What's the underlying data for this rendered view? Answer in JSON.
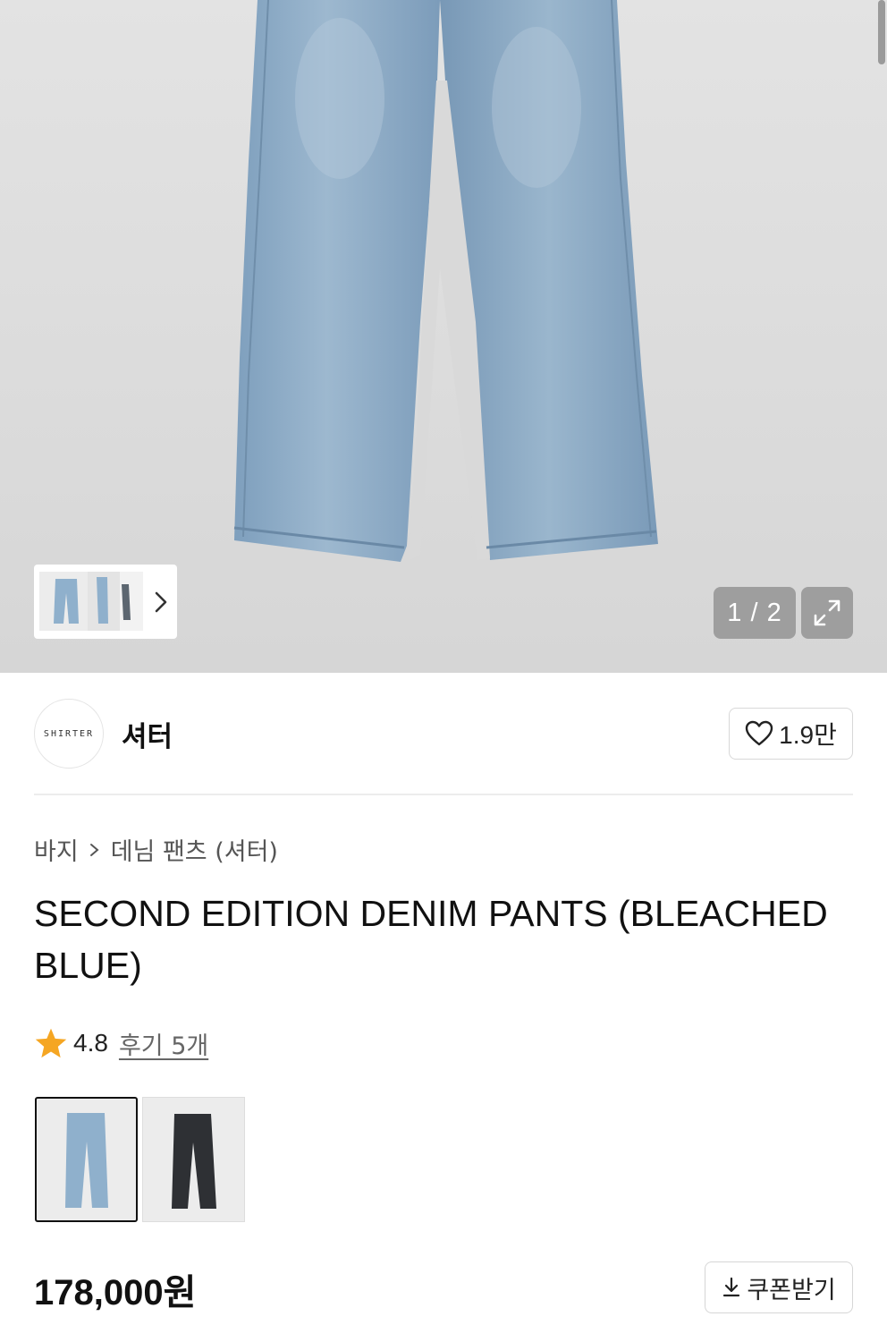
{
  "gallery": {
    "counter": "1 / 2",
    "icons": {
      "next": "chevron-right-icon",
      "expand": "expand-icon"
    }
  },
  "brand": {
    "logo_text": "SHIRTER",
    "name": "셔터",
    "likes": "1.9만"
  },
  "breadcrumb": {
    "items": [
      "바지",
      "데님 팬츠 (셔터)"
    ]
  },
  "product": {
    "title": "SECOND EDITION DENIM PANTS (BLEACHED BLUE)",
    "rating": "4.8",
    "reviews_label": "후기 5개",
    "price": "178,000원",
    "coupon_label": "쿠폰받기"
  },
  "colors": {
    "star": "#f5a623",
    "bleached_blue": "#8fb0cc",
    "black_denim": "#2e3034"
  }
}
